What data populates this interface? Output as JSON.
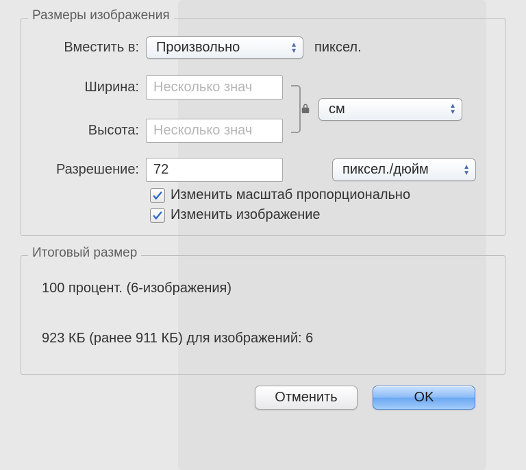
{
  "fieldset": {
    "image_sizes_legend": "Размеры изображения",
    "fit_into_label": "Вместить в:",
    "fit_into_value": "Произвольно",
    "fit_into_unit": "пиксел.",
    "width_label": "Ширина:",
    "width_placeholder": "Несколько знач",
    "height_label": "Высота:",
    "height_placeholder": "Несколько знач",
    "dim_unit_value": "см",
    "resolution_label": "Разрешение:",
    "resolution_value": "72",
    "resolution_unit_value": "пиксел./дюйм",
    "scale_prop_label": "Изменить масштаб пропорционально",
    "resample_label": "Изменить изображение",
    "scale_prop_checked": true,
    "resample_checked": true
  },
  "results": {
    "legend": "Итоговый размер",
    "line1": "100 процент. (6-изображения)",
    "line2": "923 КБ (ранее 911 КБ) для изображений: 6"
  },
  "buttons": {
    "cancel": "Отменить",
    "ok": "OK"
  }
}
